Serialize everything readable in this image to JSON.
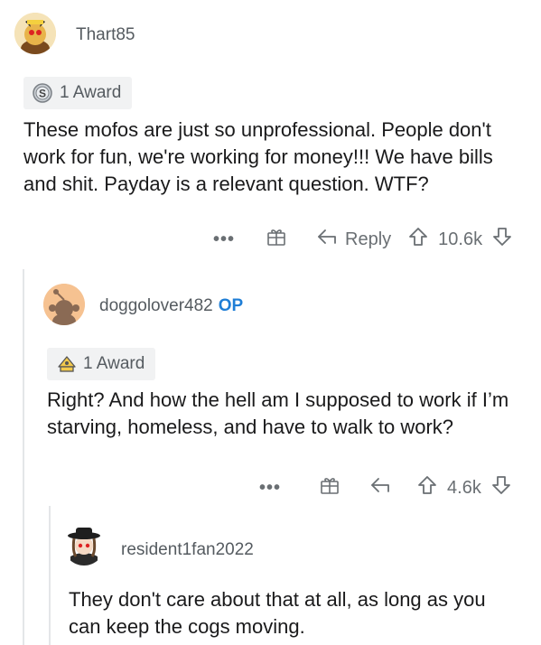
{
  "comments": [
    {
      "username": "Thart85",
      "op_badge": "",
      "award_label": "1 Award",
      "text": "These mofos are just so unprofessional. People don't work for fun, we're working for money!!! We have bills and shit. Payday is a relevant question. WTF?",
      "reply_label": "Reply",
      "votes": "10.6k"
    },
    {
      "username": "doggolover482",
      "op_badge": "OP",
      "award_label": "1 Award",
      "text": "Right? And how the hell am I supposed to work if I’m starving, homeless, and have to walk to work?",
      "reply_label": "",
      "votes": "4.6k"
    },
    {
      "username": "resident1fan2022",
      "op_badge": "",
      "award_label": "",
      "text": "They don't care about that at all, as long as you can keep the cogs moving.",
      "reply_label": "",
      "votes": ""
    }
  ],
  "more_label": "•••",
  "icons": {
    "award1": "silver-s-award-icon",
    "award2": "helpful-hat-award-icon",
    "gift": "gift-icon",
    "reply": "reply-arrow-icon",
    "upvote": "upvote-arrow-icon",
    "downvote": "downvote-arrow-icon"
  },
  "colors": {
    "op": "#1f7ed6",
    "text": "#1a1a1b",
    "meta": "#555b60"
  }
}
